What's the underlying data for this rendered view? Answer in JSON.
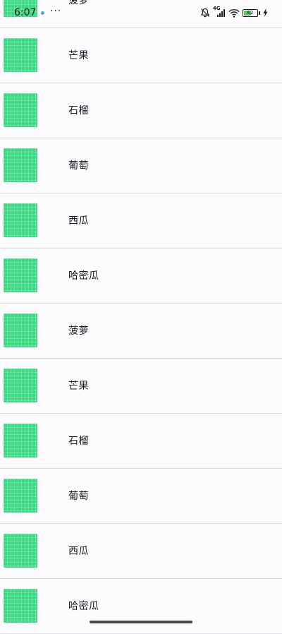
{
  "status_bar": {
    "time": "6:07",
    "more": "···",
    "network": "4G",
    "battery_percent": 62,
    "battery_text": "62"
  },
  "list": {
    "items": [
      {
        "label": "菠萝"
      },
      {
        "label": "芒果"
      },
      {
        "label": "石榴"
      },
      {
        "label": "葡萄"
      },
      {
        "label": "西瓜"
      },
      {
        "label": "哈密瓜"
      },
      {
        "label": "菠萝"
      },
      {
        "label": "芒果"
      },
      {
        "label": "石榴"
      },
      {
        "label": "葡萄"
      },
      {
        "label": "西瓜"
      },
      {
        "label": "哈密瓜"
      }
    ]
  },
  "colors": {
    "thumbnail": "#3dd883",
    "background": "#fcfbfe",
    "divider": "#dcdbe0",
    "battery_fill": "#5ac25a"
  },
  "icons": {
    "thumbnail": "green-grid-image-icon",
    "mute": "bell-off-icon",
    "signal": "cellular-signal-icon",
    "wifi": "wifi-icon",
    "battery": "battery-icon",
    "charging": "charging-bolt-icon"
  }
}
